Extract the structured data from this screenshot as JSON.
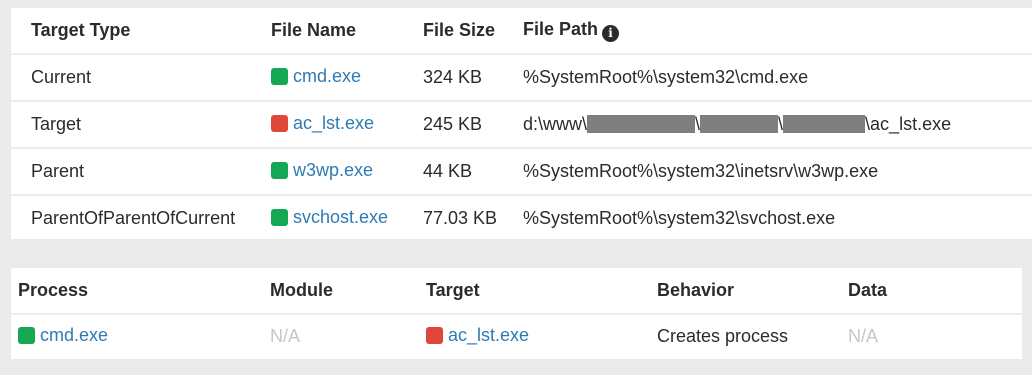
{
  "target_table": {
    "headers": {
      "target_type": "Target Type",
      "file_name": "File Name",
      "file_size": "File Size",
      "file_path": "File Path"
    },
    "info_icon": "info-circle-icon",
    "rows": [
      {
        "target_type": "Current",
        "status": "green",
        "file_name": "cmd.exe",
        "file_size": "324 KB",
        "file_path": "%SystemRoot%\\system32\\cmd.exe"
      },
      {
        "target_type": "Target",
        "status": "red",
        "file_name": "ac_lst.exe",
        "file_size": "245 KB",
        "file_path_prefix": "d:\\www\\",
        "file_path_suffix": "\\ac_lst.exe"
      },
      {
        "target_type": "Parent",
        "status": "green",
        "file_name": "w3wp.exe",
        "file_size": "44 KB",
        "file_path": "%SystemRoot%\\system32\\inetsrv\\w3wp.exe"
      },
      {
        "target_type": "ParentOfParentOfCurrent",
        "status": "green",
        "file_name": "svchost.exe",
        "file_size": "77.03 KB",
        "file_path": "%SystemRoot%\\system32\\svchost.exe"
      }
    ]
  },
  "behavior_table": {
    "headers": {
      "process": "Process",
      "module": "Module",
      "target": "Target",
      "behavior": "Behavior",
      "data": "Data"
    },
    "rows": [
      {
        "process": "cmd.exe",
        "process_status": "green",
        "module": "N/A",
        "target": "ac_lst.exe",
        "target_status": "red",
        "behavior": "Creates process",
        "data": "N/A"
      }
    ]
  },
  "colors": {
    "green": "#15a854",
    "red": "#e0473a",
    "link": "#2e7bb4",
    "muted": "#c6c6c6",
    "background": "#ebebeb"
  }
}
